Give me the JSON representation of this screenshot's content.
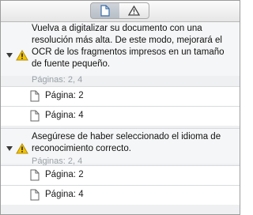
{
  "toolbar": {
    "tabs": [
      {
        "name": "document-icon",
        "selected": true
      },
      {
        "name": "warning-icon",
        "selected": false
      }
    ]
  },
  "issues": [
    {
      "message_lines": [
        "Vuelva a digitalizar su documento con una",
        "resolución más alta. De este modo, mejorará el",
        "OCR de los fragmentos impresos en un tamaño",
        "de fuente pequeño."
      ],
      "pages_label": "Páginas: 2, 4",
      "pages": [
        "Página: 2",
        "Página: 4"
      ]
    },
    {
      "message_lines": [
        "Asegúrese de haber seleccionado el idioma de",
        "reconocimiento correcto."
      ],
      "pages_label": "Páginas: 2, 4",
      "pages": [
        "Página: 2",
        "Página: 4"
      ]
    }
  ],
  "colors": {
    "warning": "#f3c400",
    "panel": "#eef0f2",
    "muted": "#9aa0a6"
  }
}
